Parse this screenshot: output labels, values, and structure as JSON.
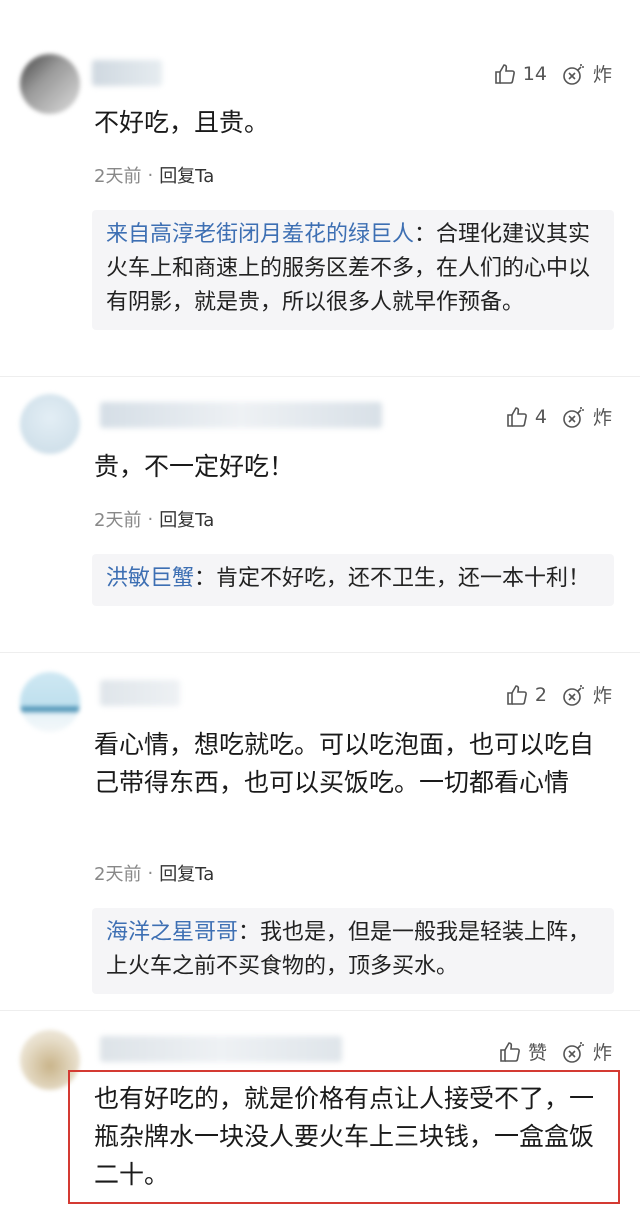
{
  "comments": [
    {
      "text": "不好吃，且贵。",
      "likes": "14",
      "bomb_label": "炸",
      "time": "2天前",
      "dot": "·",
      "reply_label": "回复Ta",
      "reply": {
        "name": "来自高淳老街闭月羞花的绿巨人",
        "colon": "：",
        "text": "合理化建议其实火车上和商速上的服务区差不多，在人们的心中以有阴影，就是贵，所以很多人就早作预备。"
      }
    },
    {
      "text": "贵，不一定好吃！",
      "likes": "4",
      "bomb_label": "炸",
      "time": "2天前",
      "dot": "·",
      "reply_label": "回复Ta",
      "reply": {
        "name": "洪敏巨蟹",
        "colon": "：",
        "text": "肯定不好吃，还不卫生，还一本十利！"
      }
    },
    {
      "text": "看心情，想吃就吃。可以吃泡面，也可以吃自己带得东西，也可以买饭吃。一切都看心情",
      "likes": "2",
      "bomb_label": "炸",
      "time": "2天前",
      "dot": "·",
      "reply_label": "回复Ta",
      "reply": {
        "name": "海洋之星哥哥",
        "colon": "：",
        "text": "我也是，但是一般我是轻装上阵，上火车之前不买食物的，顶多买水。"
      }
    },
    {
      "text": "也有好吃的，就是价格有点让人接受不了，一瓶杂牌水一块没人要火车上三块钱，一盒盒饭二十。",
      "likes": "赞",
      "bomb_label": "炸"
    }
  ],
  "colors": {
    "reply_name": "#3d6fb3",
    "highlight_border": "#d43a32",
    "reply_bg": "#f5f5f7"
  }
}
